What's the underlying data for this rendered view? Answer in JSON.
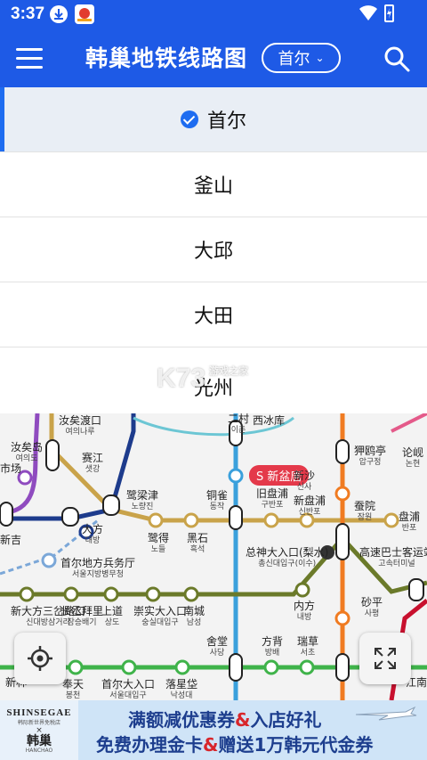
{
  "status_bar": {
    "time": "3:37"
  },
  "app_bar": {
    "title": "韩巢地铁线路图",
    "city_selected": "首尔",
    "city_chevron": "⌄"
  },
  "dropdown": {
    "items": [
      {
        "label": "首尔",
        "selected": true
      },
      {
        "label": "釜山",
        "selected": false
      },
      {
        "label": "大邱",
        "selected": false
      },
      {
        "label": "大田",
        "selected": false
      },
      {
        "label": "光州",
        "selected": false
      }
    ]
  },
  "watermark": {
    "text": "K73",
    "sub": "游戏之家"
  },
  "map": {
    "badge": "S 新盆唐",
    "stations": [
      {
        "name": "汝矣渡口",
        "sub": "여의나루"
      },
      {
        "name": "二村",
        "sub": "이촌"
      },
      {
        "name": "西冰库",
        "sub": ""
      },
      {
        "name": "狎鸥亭",
        "sub": "압구정"
      },
      {
        "name": "论岘",
        "sub": "논현"
      },
      {
        "name": "汝矣岛",
        "sub": "여의도"
      },
      {
        "name": "赛江",
        "sub": "샛강"
      },
      {
        "name": "市场",
        "sub": ""
      },
      {
        "name": "新沙",
        "sub": "신사"
      },
      {
        "name": "鹭梁津",
        "sub": "노량진"
      },
      {
        "name": "铜雀",
        "sub": "동작"
      },
      {
        "name": "旧盘浦",
        "sub": "구반포"
      },
      {
        "name": "新盘浦",
        "sub": "신반포"
      },
      {
        "name": "蚕院",
        "sub": "잠원"
      },
      {
        "name": "盘浦",
        "sub": "반포"
      },
      {
        "name": "大方",
        "sub": "대방"
      },
      {
        "name": "鹭得",
        "sub": "노들"
      },
      {
        "name": "黑石",
        "sub": "흑석"
      },
      {
        "name": "新吉",
        "sub": ""
      },
      {
        "name": "首尔地方兵务厅",
        "sub": "서울지방병무청"
      },
      {
        "name": "总神大入口(梨水)",
        "sub": "총신대입구(이수)"
      },
      {
        "name": "高速巴士客运站",
        "sub": "고속터미널"
      },
      {
        "name": "新大方三岔路口",
        "sub": "신대방삼거리"
      },
      {
        "name": "长丞拜里",
        "sub": "장승배기"
      },
      {
        "name": "上道",
        "sub": "상도"
      },
      {
        "name": "崇实大入口",
        "sub": "숭실대입구"
      },
      {
        "name": "南城",
        "sub": "남성"
      },
      {
        "name": "内方",
        "sub": "내방"
      },
      {
        "name": "砂平",
        "sub": "사평"
      },
      {
        "name": "舍堂",
        "sub": "사당"
      },
      {
        "name": "方背",
        "sub": "방배"
      },
      {
        "name": "瑞草",
        "sub": "서초"
      },
      {
        "name": "新林",
        "sub": ""
      },
      {
        "name": "奉天",
        "sub": "봉천"
      },
      {
        "name": "首尔大入口",
        "sub": "서울대입구"
      },
      {
        "name": "落星垈",
        "sub": "낙성대"
      },
      {
        "name": "江南",
        "sub": ""
      }
    ]
  },
  "ad": {
    "brand": "SHINSEGAE",
    "brand_sub": "韩际新世界免税店",
    "brand_x": "×",
    "brand2": "韩巢",
    "brand2_sub": "HANCHAO",
    "line1_a": "满额减优惠券",
    "line1_amp": "&",
    "line1_b": "入店好礼",
    "line2_a": "免费办理金卡",
    "line2_amp": "&",
    "line2_b": "赠送1万韩元代金券"
  },
  "colors": {
    "primary": "#1e5ae6",
    "selected_bg": "#e9eef5",
    "check": "#1e6cf0",
    "line9": "#c9a34a",
    "line4": "#3aa0dc",
    "line3": "#f07b21",
    "line7": "#6b7a2a",
    "line2": "#3fb34a",
    "line5": "#8f4bbf",
    "shinbundang": "#c8102e"
  }
}
